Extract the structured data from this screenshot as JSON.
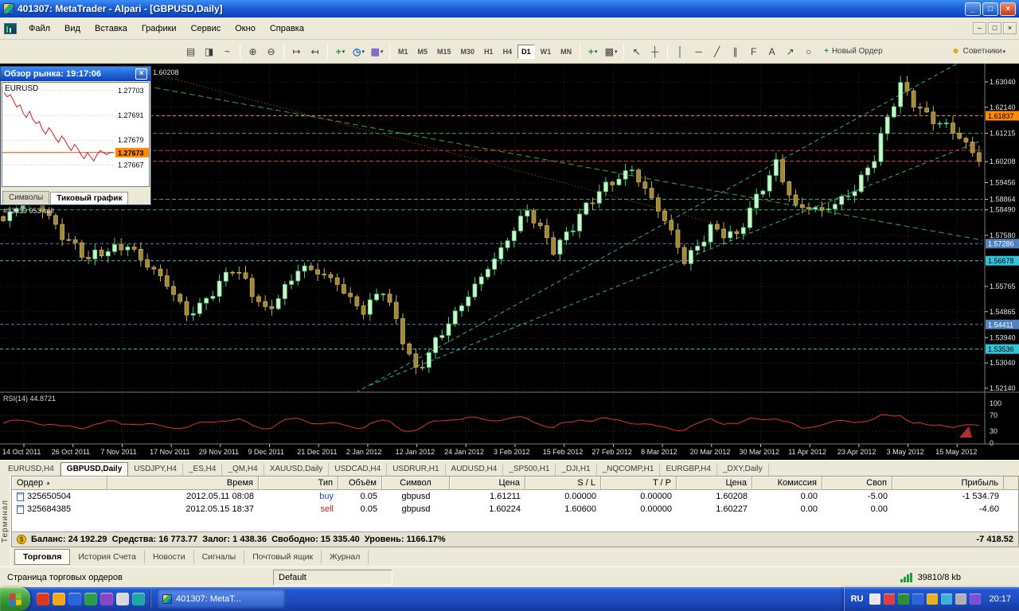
{
  "window": {
    "title": "401307: MetaTrader - Alpari - [GBPUSD,Daily]",
    "minimize_glyph": "_",
    "maximize_glyph": "□",
    "close_glyph": "×"
  },
  "menu": {
    "items": [
      "Файл",
      "Вид",
      "Вставка",
      "Графики",
      "Сервис",
      "Окно",
      "Справка"
    ],
    "mdi_minimize": "–",
    "mdi_restore": "□",
    "mdi_close": "×"
  },
  "toolbar": {
    "left_buttons": [
      {
        "name": "bar-chart-icon",
        "glyph": "▤"
      },
      {
        "name": "candlestick-chart-icon",
        "glyph": "◨"
      },
      {
        "name": "line-chart-icon",
        "glyph": "~"
      },
      {
        "sep": true
      },
      {
        "name": "zoom-in-icon",
        "glyph": "⊕"
      },
      {
        "name": "zoom-out-icon",
        "glyph": "⊖"
      },
      {
        "sep": true
      },
      {
        "name": "auto-scroll-icon",
        "glyph": "↦"
      },
      {
        "name": "chart-shift-icon",
        "glyph": "↤"
      },
      {
        "sep": true
      },
      {
        "name": "indicators-icon",
        "glyph": "+",
        "color": "#1f9d3a",
        "dropdown": true
      },
      {
        "name": "periods-icon",
        "glyph": "◷",
        "color": "#1a66cc",
        "dropdown": true
      },
      {
        "name": "templates-icon",
        "glyph": "▦",
        "color": "#7a5ccc",
        "dropdown": true
      },
      {
        "sep": true
      }
    ],
    "timeframes": [
      "M1",
      "M5",
      "M15",
      "M30",
      "H1",
      "H4",
      "D1",
      "W1",
      "MN"
    ],
    "active_timeframe": "D1",
    "right_buttons": [
      {
        "sep": true
      },
      {
        "name": "add-indicator-icon",
        "glyph": "+",
        "color": "#1f9d3a",
        "dropdown": true
      },
      {
        "name": "template-presets-icon",
        "glyph": "▩",
        "dropdown": true
      },
      {
        "sep": true
      },
      {
        "name": "cursor-icon",
        "glyph": "↖"
      },
      {
        "name": "crosshair-icon",
        "glyph": "┼"
      },
      {
        "sep": true
      },
      {
        "name": "vertical-line-icon",
        "glyph": "│"
      },
      {
        "name": "horizontal-line-icon",
        "glyph": "─"
      },
      {
        "name": "trendline-icon",
        "glyph": "╱"
      },
      {
        "name": "channel-icon",
        "glyph": "∥"
      },
      {
        "name": "fibonacci-icon",
        "glyph": "F"
      },
      {
        "name": "text-label-icon",
        "glyph": "A"
      },
      {
        "name": "arrow-tools-icon",
        "glyph": "↗"
      },
      {
        "name": "shapes-icon",
        "glyph": "○"
      }
    ],
    "new_order_label": "Новый Ордер",
    "advisors_label": "Советники"
  },
  "market_watch": {
    "title": "Обзор рынка: 19:17:06",
    "close_glyph": "×",
    "symbol": "EURUSD",
    "price_labels": [
      "1.27703",
      "1.27691",
      "1.27679",
      "1.27667"
    ],
    "current_price": "1.27673",
    "tabs": [
      {
        "label": "Символы",
        "active": false
      },
      {
        "label": "Тиковый график",
        "active": true
      }
    ],
    "tick_data": [
      1.27702,
      1.277,
      1.27701,
      1.27698,
      1.27695,
      1.27696,
      1.27692,
      1.2769,
      1.27693,
      1.27689,
      1.27687,
      1.27688,
      1.27684,
      1.27682,
      1.27685,
      1.27683,
      1.2768,
      1.27678,
      1.27681,
      1.27679,
      1.27676,
      1.27674,
      1.27677,
      1.27675,
      1.27672,
      1.2767,
      1.27673,
      1.27671,
      1.27669,
      1.27672,
      1.27674,
      1.27673,
      1.27672,
      1.27673,
      1.27673
    ]
  },
  "chart_data": {
    "type": "candlestick",
    "symbol": "GBPUSD",
    "period": "Daily",
    "corner_price": "1.60208",
    "annotation": "#32539 953 sell",
    "y_range": [
      1.5214,
      1.6304
    ],
    "price_ticks": [
      "1.63040",
      "1.62140",
      "1.61215",
      "1.60208",
      "1.59456",
      "1.58864",
      "1.58490",
      "1.57580",
      "1.55765",
      "1.54865",
      "1.53940",
      "1.53040",
      "1.52140"
    ],
    "highlight_ticks": [
      {
        "label": "1.61837",
        "bg": "#ff8a00",
        "fg": "#000000"
      },
      {
        "label": "1.57286",
        "bg": "#4f81bd",
        "fg": "#ffffff"
      },
      {
        "label": "1.56678",
        "bg": "#31c5da",
        "fg": "#000000"
      },
      {
        "label": "1.54411",
        "bg": "#4f81bd",
        "fg": "#ffffff"
      },
      {
        "label": "1.53536",
        "bg": "#31c5da",
        "fg": "#000000"
      }
    ],
    "dates": [
      "14 Oct 2011",
      "26 Oct 2011",
      "7 Nov 2011",
      "17 Nov 2011",
      "29 Nov 2011",
      "9 Dec 2011",
      "21 Dec 2011",
      "2 Jan 2012",
      "12 Jan 2012",
      "24 Jan 2012",
      "3 Feb 2012",
      "15 Feb 2012",
      "27 Feb 2012",
      "8 Mar 2012",
      "20 Mar 2012",
      "30 Mar 2012",
      "11 Apr 2012",
      "23 Apr 2012",
      "3 May 2012",
      "15 May 2012"
    ],
    "candles": {
      "count": 150,
      "last_close": 1.60208,
      "anchors": [
        [
          0,
          1.581
        ],
        [
          5,
          1.589
        ],
        [
          13,
          1.566
        ],
        [
          19,
          1.574
        ],
        [
          28,
          1.548
        ],
        [
          35,
          1.563
        ],
        [
          40,
          1.55
        ],
        [
          45,
          1.563
        ],
        [
          51,
          1.56
        ],
        [
          55,
          1.549
        ],
        [
          58,
          1.555
        ],
        [
          63,
          1.529
        ],
        [
          66,
          1.538
        ],
        [
          69,
          1.546
        ],
        [
          74,
          1.566
        ],
        [
          80,
          1.583
        ],
        [
          84,
          1.572
        ],
        [
          88,
          1.583
        ],
        [
          96,
          1.601
        ],
        [
          99,
          1.589
        ],
        [
          104,
          1.566
        ],
        [
          108,
          1.58
        ],
        [
          112,
          1.574
        ],
        [
          118,
          1.603
        ],
        [
          121,
          1.586
        ],
        [
          125,
          1.583
        ],
        [
          130,
          1.594
        ],
        [
          133,
          1.603
        ],
        [
          137,
          1.6285
        ],
        [
          141,
          1.62
        ],
        [
          144,
          1.614
        ],
        [
          149,
          1.60208
        ]
      ]
    },
    "colors": {
      "up_fill": "#cdf3cf",
      "up_border": "#49d177",
      "down_fill": "#a08a3a",
      "down_border": "#c9ad52",
      "background": "#000000",
      "grid": "#242424"
    },
    "hlines": [
      {
        "price": 1.61837,
        "color": "#ff8a00",
        "dash": "4,3"
      },
      {
        "price": 1.61211,
        "color": "#2fae4f",
        "dash": "5,3"
      },
      {
        "price": 1.606,
        "color": "#e03030",
        "dash": "5,3"
      },
      {
        "price": 1.60224,
        "color": "#e03030",
        "dash": "5,3"
      },
      {
        "price": 1.58864,
        "color": "#2fae4f",
        "dash": "5,3"
      },
      {
        "price": 1.5849,
        "color": "#2fae4f",
        "dash": "5,3"
      },
      {
        "price": 1.57286,
        "color": "#4f81bd",
        "dash": "4,3"
      },
      {
        "price": 1.56678,
        "color": "#31c5da",
        "dash": "4,3"
      },
      {
        "price": 1.54411,
        "color": "#4f81bd",
        "dash": "4,3"
      },
      {
        "price": 1.53536,
        "color": "#31c5da",
        "dash": "4,3"
      }
    ],
    "trendlines": [
      {
        "i1": 14,
        "p1": 1.639,
        "i2": 108,
        "p2": 1.5805,
        "color": "#cc4444",
        "dash": "1,3"
      },
      {
        "i1": 50,
        "p1": 1.515,
        "i2": 152,
        "p2": 1.645,
        "color": "#2fae8f",
        "dash": "5,4"
      },
      {
        "i1": 56,
        "p1": 1.5225,
        "i2": 152,
        "p2": 1.612,
        "color": "#2fae8f",
        "dash": "5,4"
      },
      {
        "i1": 10,
        "p1": 1.634,
        "i2": 152,
        "p2": 1.573,
        "color": "#3aa43a",
        "dash": "7,4"
      }
    ],
    "rsi": {
      "label": "RSI(14) 44.8721",
      "levels": [
        100,
        70,
        30,
        0
      ],
      "last": 44.8721,
      "color": "#e03030"
    }
  },
  "chart_tabs": {
    "items": [
      "EURUSD,H4",
      "GBPUSD,Daily",
      "USDJPY,H4",
      "_ES,H4",
      "_QM,H4",
      "XAUUSD,Daily",
      "USDCAD,H4",
      "USDRUR,H1",
      "AUDUSD,H4",
      "_SP500,H1",
      "_DJI,H1",
      "_NQCOMP,H1",
      "EURGBP,H4",
      "_DXY,Daily"
    ],
    "active": "GBPUSD,Daily"
  },
  "terminal": {
    "side_label": "Терминал",
    "columns": [
      {
        "label": "Ордер",
        "sort": "▲"
      },
      {
        "label": "Время"
      },
      {
        "label": "Тип"
      },
      {
        "label": "Объём"
      },
      {
        "label": "Символ"
      },
      {
        "label": "Цена"
      },
      {
        "label": "S / L"
      },
      {
        "label": "T / P"
      },
      {
        "label": "Цена"
      },
      {
        "label": "Комиссия"
      },
      {
        "label": "Своп"
      },
      {
        "label": "Прибыль"
      }
    ],
    "orders": [
      {
        "order": "325650504",
        "time": "2012.05.11 08:08",
        "type": "buy",
        "volume": "0.05",
        "symbol": "gbpusd",
        "open_price": "1.61211",
        "sl": "0.00000",
        "tp": "0.00000",
        "price": "1.60208",
        "commission": "0.00",
        "swap": "-5.00",
        "profit": "-1 534.79"
      },
      {
        "order": "325684385",
        "time": "2012.05.15 18:37",
        "type": "sell",
        "volume": "0.05",
        "symbol": "gbpusd",
        "open_price": "1.60224",
        "sl": "1.60600",
        "tp": "0.00000",
        "price": "1.60227",
        "commission": "0.00",
        "swap": "0.00",
        "profit": "-4.60"
      }
    ],
    "balance": {
      "text": "Баланс: 24 192.29  Средства: 16 773.77  Залог: 1 438.36  Свободно: 15 335.40  Уровень: 1166.17%",
      "profit": "-7 418.52"
    },
    "tabs": [
      "Торговля",
      "История Счета",
      "Новости",
      "Сигналы",
      "Почтовый ящик",
      "Журнал"
    ],
    "active_tab": "Торговля"
  },
  "status_bar": {
    "help_text": "Страница торговых ордеров",
    "profile": "Default",
    "traffic": "39810/8 kb"
  },
  "taskbar": {
    "task_button": "401307: MetaT...",
    "quick_launch": [
      {
        "name": "quick-launch-icon-1",
        "color": "#d93a1f"
      },
      {
        "name": "quick-launch-icon-2",
        "color": "#f2a71b"
      },
      {
        "name": "quick-launch-icon-3",
        "color": "#2b66d9"
      },
      {
        "name": "quick-launch-icon-4",
        "color": "#2d9e46"
      },
      {
        "name": "quick-launch-icon-5",
        "color": "#8a46c2"
      },
      {
        "name": "quick-launch-icon-6",
        "color": "#d9d9d9"
      },
      {
        "name": "quick-launch-icon-7",
        "color": "#1fa7a0"
      }
    ],
    "tray_lang": "RU",
    "tray_icons": [
      {
        "name": "tray-icon-1",
        "color": "#e8e8e8"
      },
      {
        "name": "tray-icon-2",
        "color": "#d94040"
      },
      {
        "name": "tray-icon-3",
        "color": "#2f8f2f"
      },
      {
        "name": "tray-icon-4",
        "color": "#2b66d9"
      },
      {
        "name": "tray-icon-5",
        "color": "#e8b21f"
      },
      {
        "name": "tray-icon-6",
        "color": "#40b0d8"
      },
      {
        "name": "tray-icon-7",
        "color": "#b0b0b0"
      },
      {
        "name": "tray-icon-8",
        "color": "#7a4fd9"
      }
    ],
    "clock": "20:17"
  }
}
